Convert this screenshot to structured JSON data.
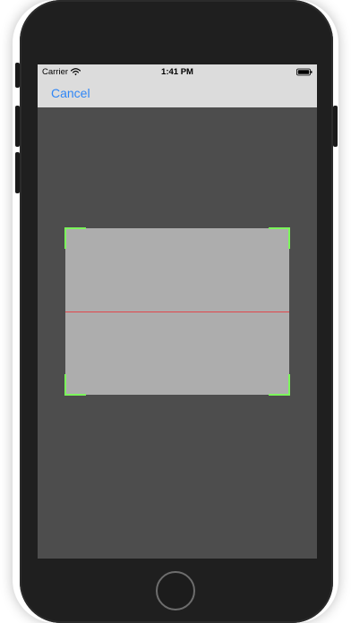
{
  "status_bar": {
    "carrier": "Carrier",
    "time": "1:41 PM",
    "icons": [
      "wifi-icon",
      "battery-icon"
    ]
  },
  "nav_bar": {
    "cancel_label": "Cancel"
  },
  "scanner": {
    "icons": [
      "corner-marker-icon"
    ]
  },
  "colors": {
    "device_body": "#1f1f1f",
    "screen_background": "#4d4d4d",
    "bar_background": "#dcdcdc",
    "accent_link": "#2f86f6",
    "scan_area": "#adadad",
    "scan_line": "#e1474b",
    "corner_markers": "#7cf65b"
  }
}
